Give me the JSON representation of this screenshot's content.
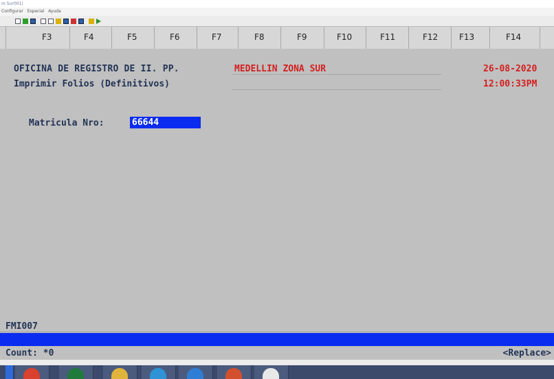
{
  "window": {
    "title": "m Sur001)"
  },
  "menu": {
    "items": [
      "Configurar",
      "Especial",
      "Ayuda"
    ]
  },
  "toolbar": {
    "icons": [
      "doc-icon",
      "save-icon",
      "image-icon",
      "copy-icon",
      "paste-icon",
      "pick-icon",
      "grid-icon",
      "arrow-icon",
      "pen-icon",
      "scissors-icon",
      "play-icon"
    ]
  },
  "fkeys": [
    "F3",
    "F4",
    "F5",
    "F6",
    "F7",
    "F8",
    "F9",
    "F10",
    "F11",
    "F12",
    "F13",
    "F14"
  ],
  "header": {
    "office": "OFICINA DE REGISTRO DE II. PP.",
    "zone": "MEDELLIN ZONA SUR",
    "date": "26-08-2020",
    "subtitle": "Imprimir Folios (Definitivos)",
    "time": "12:00:33PM"
  },
  "form": {
    "matricula_label": "Matricula Nro:",
    "matricula_value": "66644"
  },
  "footer": {
    "form_code": "FMI007",
    "count": "Count: *0",
    "mode": "<Replace>"
  },
  "colors": {
    "screen_bg": "#c0c0c0",
    "input_bg": "#0a2cf0",
    "accent_red": "#d42020",
    "text": "#223355"
  }
}
